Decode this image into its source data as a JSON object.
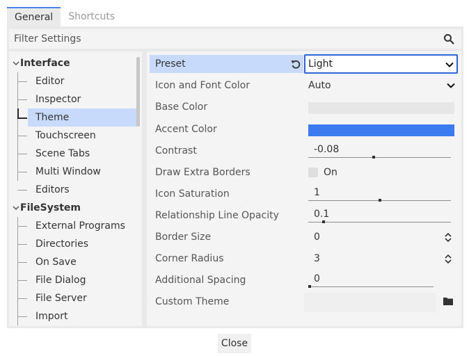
{
  "tabs": [
    {
      "label": "General",
      "active": true
    },
    {
      "label": "Shortcuts",
      "active": false
    }
  ],
  "filter": {
    "placeholder": "Filter Settings",
    "icon": "search-icon"
  },
  "tree": {
    "categories": [
      {
        "label": "Interface",
        "items": [
          "Editor",
          "Inspector",
          "Theme",
          "Touchscreen",
          "Scene Tabs",
          "Multi Window",
          "Editors"
        ]
      },
      {
        "label": "FileSystem",
        "items": [
          "External Programs",
          "Directories",
          "On Save",
          "File Dialog",
          "File Server",
          "Import"
        ]
      }
    ],
    "selected": "Theme"
  },
  "properties": [
    {
      "label": "Preset",
      "type": "select",
      "value": "Light"
    },
    {
      "label": "Icon and Font Color",
      "type": "dropdown",
      "value": "Auto"
    },
    {
      "label": "Base Color",
      "type": "color",
      "color": "#e6e6e6"
    },
    {
      "label": "Accent Color",
      "type": "color",
      "color": "#3b7bef"
    },
    {
      "label": "Contrast",
      "type": "slider",
      "value": "-0.08",
      "fraction": 0.46
    },
    {
      "label": "Draw Extra Borders",
      "type": "checkbox",
      "value": "On",
      "checked": false
    },
    {
      "label": "Icon Saturation",
      "type": "slider",
      "value": "1",
      "fraction": 0.5
    },
    {
      "label": "Relationship Line Opacity",
      "type": "slider",
      "value": "0.1",
      "fraction": 0.1
    },
    {
      "label": "Border Size",
      "type": "spin",
      "value": "0"
    },
    {
      "label": "Corner Radius",
      "type": "spin",
      "value": "3"
    },
    {
      "label": "Additional Spacing",
      "type": "slider",
      "value": "0",
      "fraction": 0.0
    },
    {
      "label": "Custom Theme",
      "type": "file",
      "value": ""
    }
  ],
  "footer": {
    "close_label": "Close"
  },
  "colors": {
    "accent": "#4a84f0",
    "selection": "#c8dafb",
    "focus_border": "#2f64d6"
  }
}
